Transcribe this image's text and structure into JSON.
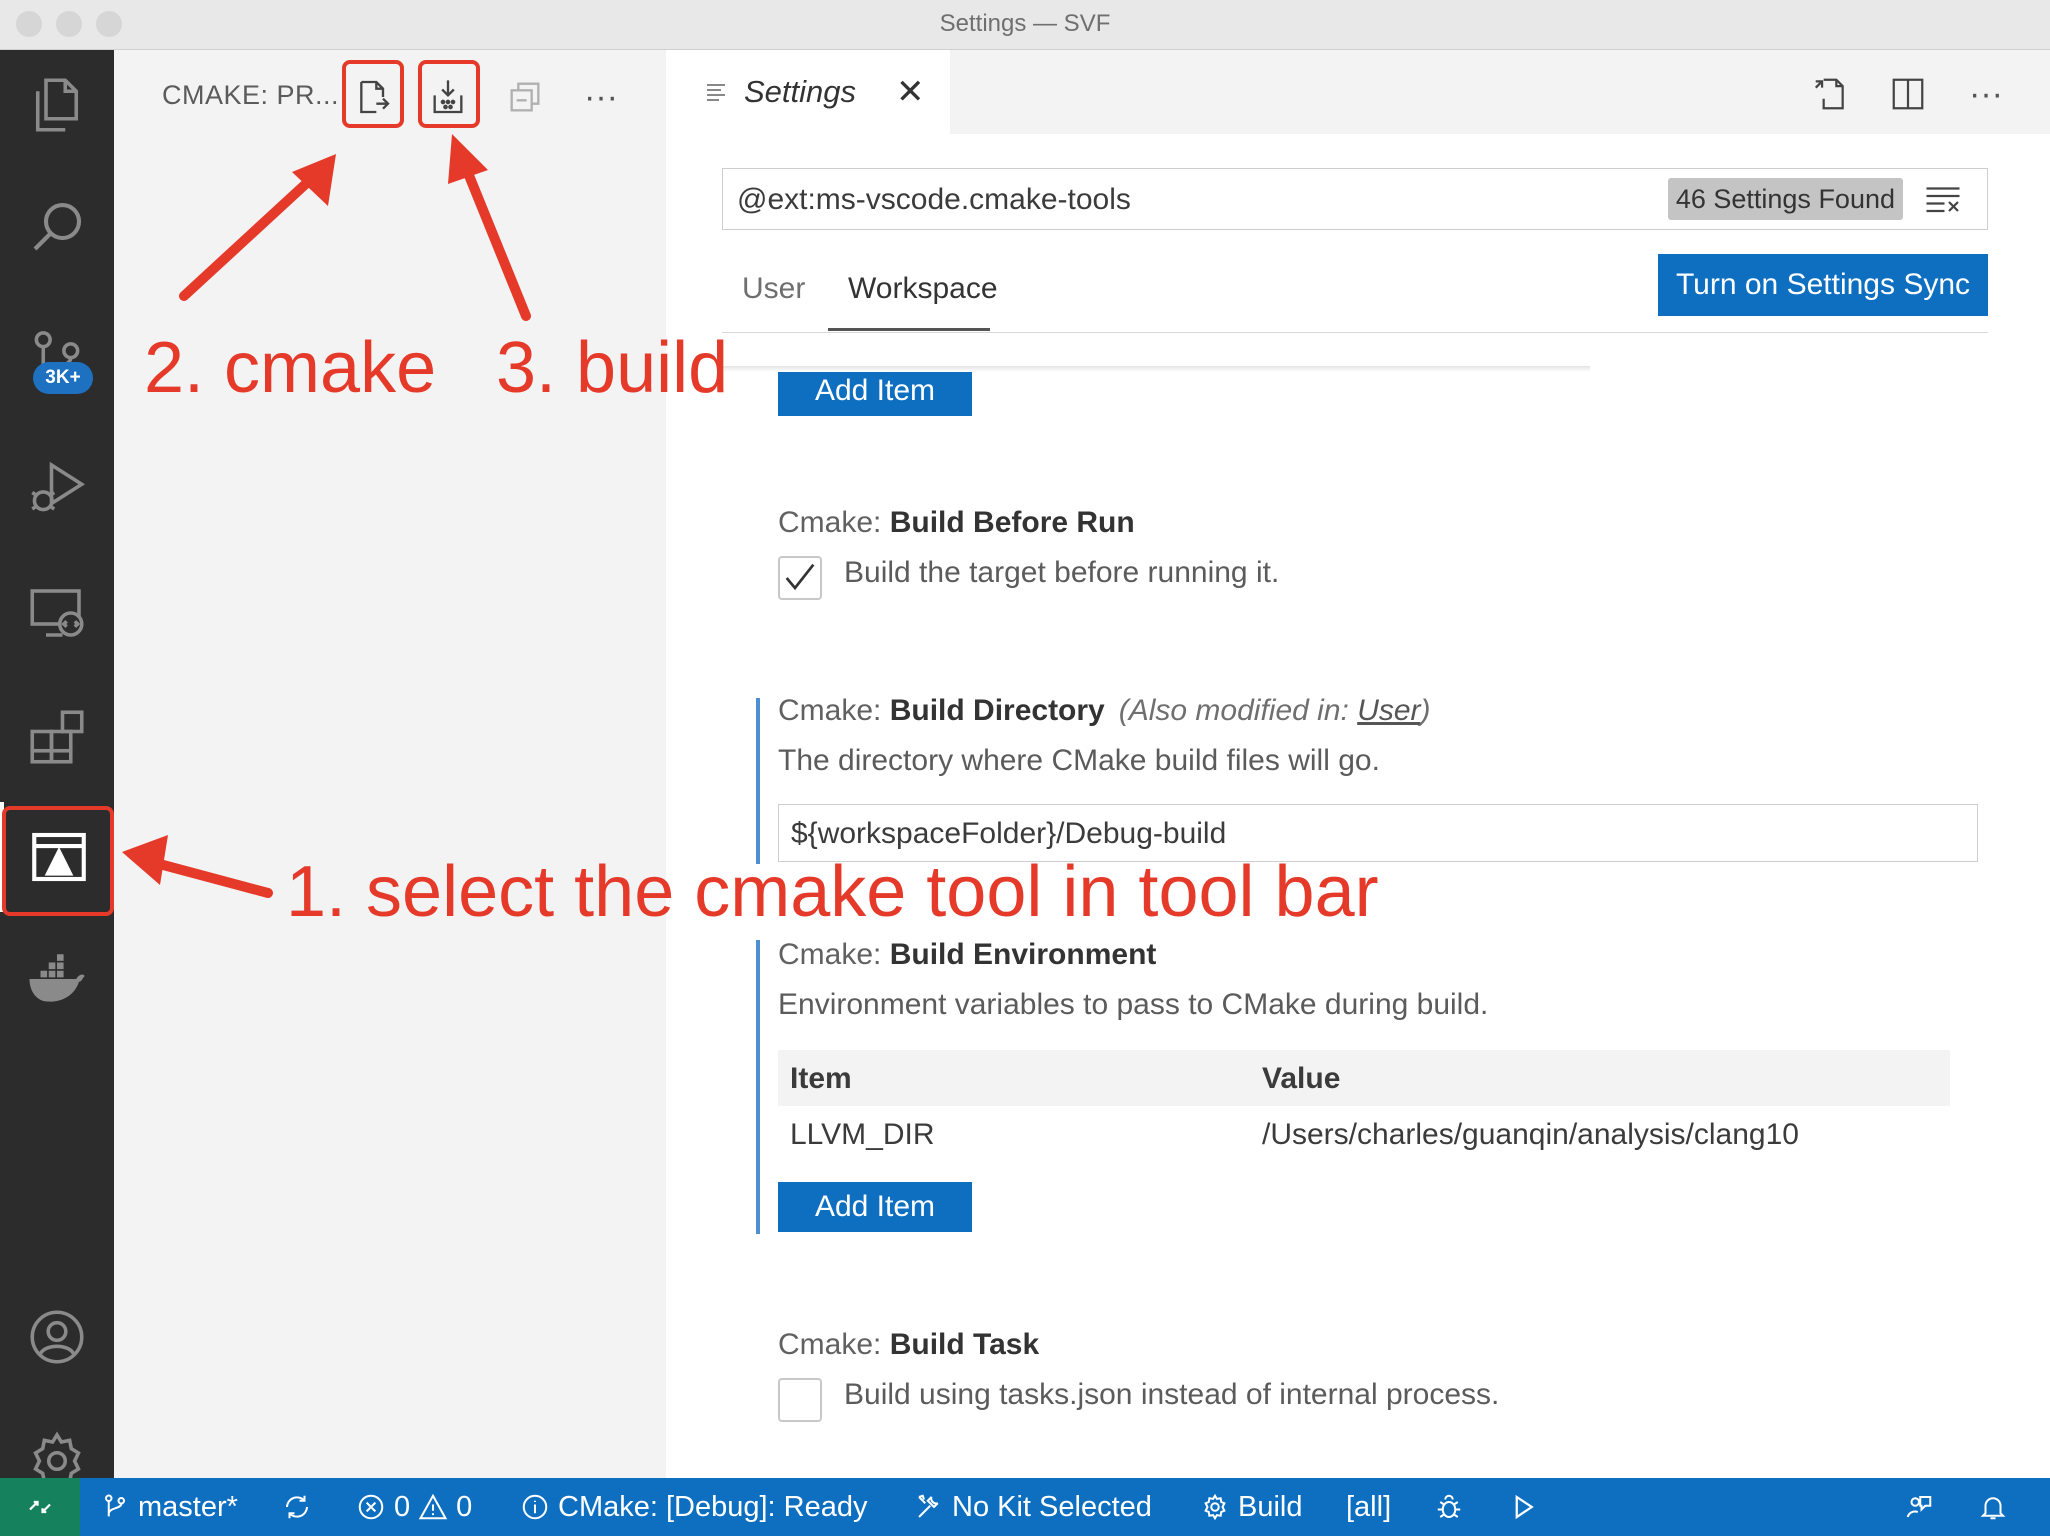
{
  "window": {
    "title": "Settings — SVF"
  },
  "activity_bar": {
    "items": [
      {
        "name": "explorer",
        "icon": "files-icon"
      },
      {
        "name": "search",
        "icon": "search-icon"
      },
      {
        "name": "source-control",
        "icon": "source-control-icon",
        "badge": "3K+"
      },
      {
        "name": "run-debug",
        "icon": "run-debug-icon"
      },
      {
        "name": "remote-explorer",
        "icon": "remote-explorer-icon"
      },
      {
        "name": "extensions",
        "icon": "extensions-icon"
      },
      {
        "name": "cmake",
        "icon": "cmake-icon",
        "active": true
      },
      {
        "name": "docker",
        "icon": "docker-icon"
      }
    ],
    "bottom": [
      {
        "name": "accounts",
        "icon": "account-icon"
      },
      {
        "name": "manage",
        "icon": "gear-icon"
      }
    ]
  },
  "side_panel": {
    "title": "CMAKE: PR...",
    "actions": [
      "configure-icon",
      "build-icon",
      "collapse-all-icon",
      "more-actions-icon"
    ],
    "more_label": "···"
  },
  "tabs": [
    {
      "label": "Settings",
      "icon": "settings-file-icon",
      "close": "✕"
    }
  ],
  "editor_actions": [
    "open-settings-json-icon",
    "split-editor-icon",
    "more-actions-icon"
  ],
  "settings": {
    "search_value": "@ext:ms-vscode.cmake-tools",
    "found_badge": "46 Settings Found",
    "scope_tabs": {
      "user": "User",
      "workspace": "Workspace",
      "active": "Workspace"
    },
    "sync_button": "Turn on Settings Sync",
    "add_item_label": "Add Item",
    "items": {
      "build_before_run": {
        "category": "Cmake: ",
        "title": "Build Before Run",
        "description": "Build the target before running it.",
        "checked": true
      },
      "build_directory": {
        "category": "Cmake: ",
        "title": "Build Directory",
        "modified_prefix": "(Also modified in: ",
        "modified_link": "User",
        "modified_suffix": ")",
        "description": "The directory where CMake build files will go.",
        "value": "${workspaceFolder}/Debug-build"
      },
      "build_environment": {
        "category": "Cmake: ",
        "title": "Build Environment",
        "description": "Environment variables to pass to CMake during build.",
        "col_item": "Item",
        "col_value": "Value",
        "rows": [
          {
            "item": "LLVM_DIR",
            "value": "/Users/charles/guanqin/analysis/clang10"
          }
        ]
      },
      "build_task": {
        "category": "Cmake: ",
        "title": "Build Task",
        "description": "Build using tasks.json instead of internal process.",
        "checked": false
      }
    }
  },
  "annotations": {
    "step1": "1. select the cmake tool in tool bar",
    "step2": "2. cmake",
    "step3": "3. build",
    "color": "#e53a2a"
  },
  "status_bar": {
    "branch": "master*",
    "errors": "0",
    "warnings": "0",
    "cmake_status": "CMake: [Debug]: Ready",
    "kit": "No Kit Selected",
    "build": "Build",
    "target": "[all]",
    "color": "#0e6fc1",
    "remote_color": "#16825d"
  }
}
